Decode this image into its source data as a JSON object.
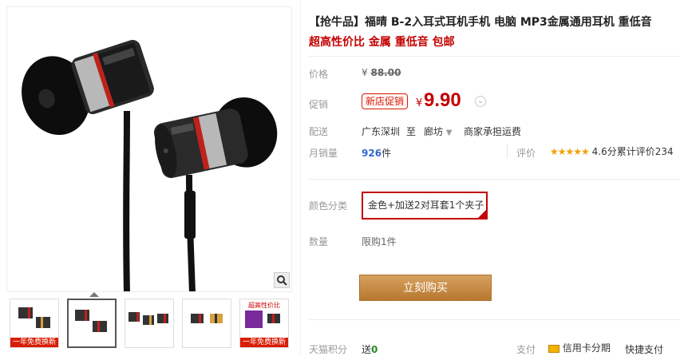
{
  "product": {
    "title": "【抢牛品】福晴 B-2入耳式耳机手机 电脑 MP3金属通用耳机 重低音",
    "subtitle": "超高性价比 金属 重低音 包邮"
  },
  "price": {
    "label": "价格",
    "currency": "¥",
    "original": "88.00"
  },
  "promo": {
    "label": "促销",
    "badge": "新店促销",
    "currency": "¥",
    "price": "9.90"
  },
  "shipping": {
    "label": "配送",
    "from": "广东深圳",
    "to_word": "至",
    "to": "廊坊",
    "fee": "商家承担运费"
  },
  "sales": {
    "label": "月销量",
    "count": "926",
    "unit": "件",
    "review_label": "评价",
    "stars": "★★★★★",
    "rating": "4.6分",
    "review_text": "累计评价234"
  },
  "color": {
    "label": "颜色分类",
    "selected": "金色+加送2对耳套1个夹子"
  },
  "quantity": {
    "label": "数量",
    "limit": "限购1件"
  },
  "buy": {
    "label": "立刻购买"
  },
  "footer": {
    "points_label": "天猫积分",
    "points_prefix": "送",
    "points_value": "0",
    "pay_label": "支付",
    "pay_method": "信用卡分期",
    "quick_pay": "快捷支付"
  },
  "thumbs": [
    {
      "tag": "一年免费换新",
      "tag_top": ""
    },
    {
      "tag": "",
      "tag_top": ""
    },
    {
      "tag": "",
      "tag_top": ""
    },
    {
      "tag": "",
      "tag_top": ""
    },
    {
      "tag": "一年免费换新",
      "tag_top": "超高性价比"
    }
  ],
  "colors": {
    "accent": "#c40000",
    "buy_button": "#c8893f",
    "sales_blue": "#3366cc",
    "star": "#f0a000"
  },
  "icons": {
    "zoom": "magnifier-icon",
    "dropdown": "chevron-down-icon",
    "card": "credit-card-icon"
  }
}
